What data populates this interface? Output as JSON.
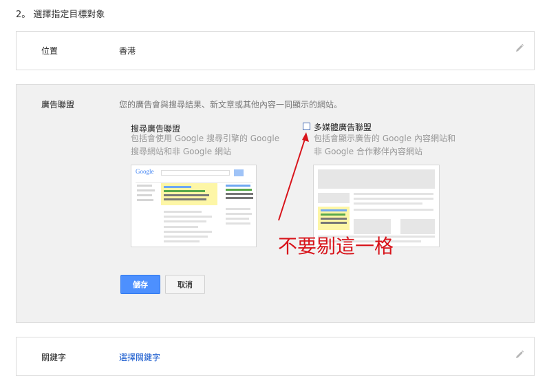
{
  "step": {
    "title": "2。 選擇指定目標對象"
  },
  "location": {
    "label": "位置",
    "value": "香港"
  },
  "network": {
    "label": "廣告聯盟",
    "description": "您的廣告會與搜尋結果、新文章或其他內容一同顯示的網站。",
    "search": {
      "title": "搜尋廣告聯盟",
      "line1": "包括會使用 Google 搜尋引擎的 Google",
      "line2": "搜尋網站和非 Google 網站"
    },
    "display": {
      "title": "多媒體廣告聯盟",
      "line1": "包括會顯示廣告的 Google 內容網站和",
      "line2": "非 Google 合作夥伴內容網站",
      "checked": false
    },
    "save_label": "儲存",
    "cancel_label": "取消"
  },
  "keywords": {
    "label": "關鍵字",
    "value": "選擇關鍵字"
  },
  "annotation": {
    "text": "不要剔這一格",
    "color": "#d8141b"
  },
  "thumbnail": {
    "google_logo": "Google"
  },
  "colors": {
    "accent": "#4d90fe",
    "link": "#1155cc",
    "highlight": "#fdf6a6"
  },
  "icons": {
    "edit": "pencil-icon",
    "checkbox": "checkbox-icon",
    "arrow": "arrow-icon"
  }
}
